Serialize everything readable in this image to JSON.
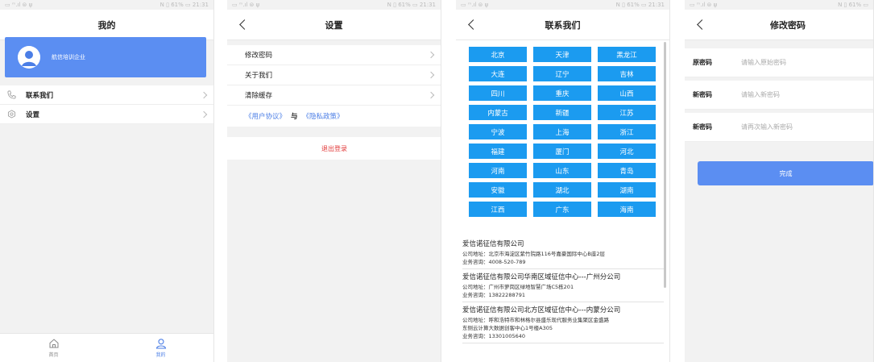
{
  "status": {
    "left": "▭ ᵐ.ıl ⊜ ψ",
    "right": "N ▯ 61% ▭ 21:31",
    "right_cut": "N ▯ 61% ▭"
  },
  "screen1": {
    "title": "我的",
    "company": "航信培训企业",
    "menu": [
      {
        "icon": "phone-icon",
        "label": "联系我们"
      },
      {
        "icon": "gear-icon",
        "label": "设置"
      }
    ],
    "tabs": [
      {
        "icon": "home-icon",
        "label": "首页",
        "active": false
      },
      {
        "icon": "user-icon",
        "label": "我的",
        "active": true
      }
    ]
  },
  "screen2": {
    "title": "设置",
    "items": [
      "修改密码",
      "关于我们",
      "清除缓存"
    ],
    "agreement": "《用户协议》",
    "and": "与",
    "privacy": "《隐私政策》",
    "logout": "退出登录"
  },
  "screen3": {
    "title": "联系我们",
    "cities": [
      "北京",
      "天津",
      "黑龙江",
      "大连",
      "辽宁",
      "吉林",
      "四川",
      "重庆",
      "山西",
      "内蒙古",
      "新疆",
      "江苏",
      "宁波",
      "上海",
      "浙江",
      "福建",
      "厦门",
      "河北",
      "河南",
      "山东",
      "青岛",
      "安徽",
      "湖北",
      "湖南",
      "江西",
      "广东",
      "海南"
    ],
    "offices": [
      {
        "name": "爱信诺征信有限公司",
        "lines": [
          "公司地址：北京市海淀区紫竹院路116号嘉豪国际中心B座2层",
          "业务咨询：4008-520-789"
        ]
      },
      {
        "name": "爱信诺征信有限公司华南区域征信中心---广州分公司",
        "lines": [
          "公司地址：广州市萝岗区绿地智慧广场C5栋201",
          "业务咨询：13822288791"
        ]
      },
      {
        "name": "爱信诺征信有限公司北方区域征信中心---内蒙分公司",
        "lines": [
          "公司地址：呼和浩特市和林格尔县盛乐现代服务业集聚区金盛路",
          "东侧云计算大数据创客中心1号楼A305",
          "业务咨询：13301005640"
        ]
      }
    ]
  },
  "screen4": {
    "title": "修改密码",
    "fields": [
      {
        "label": "原密码",
        "placeholder": "请输入原始密码"
      },
      {
        "label": "新密码",
        "placeholder": "请输入新密码"
      },
      {
        "label": "新密码",
        "placeholder": "请再次输入新密码"
      }
    ],
    "submit": "完成"
  }
}
